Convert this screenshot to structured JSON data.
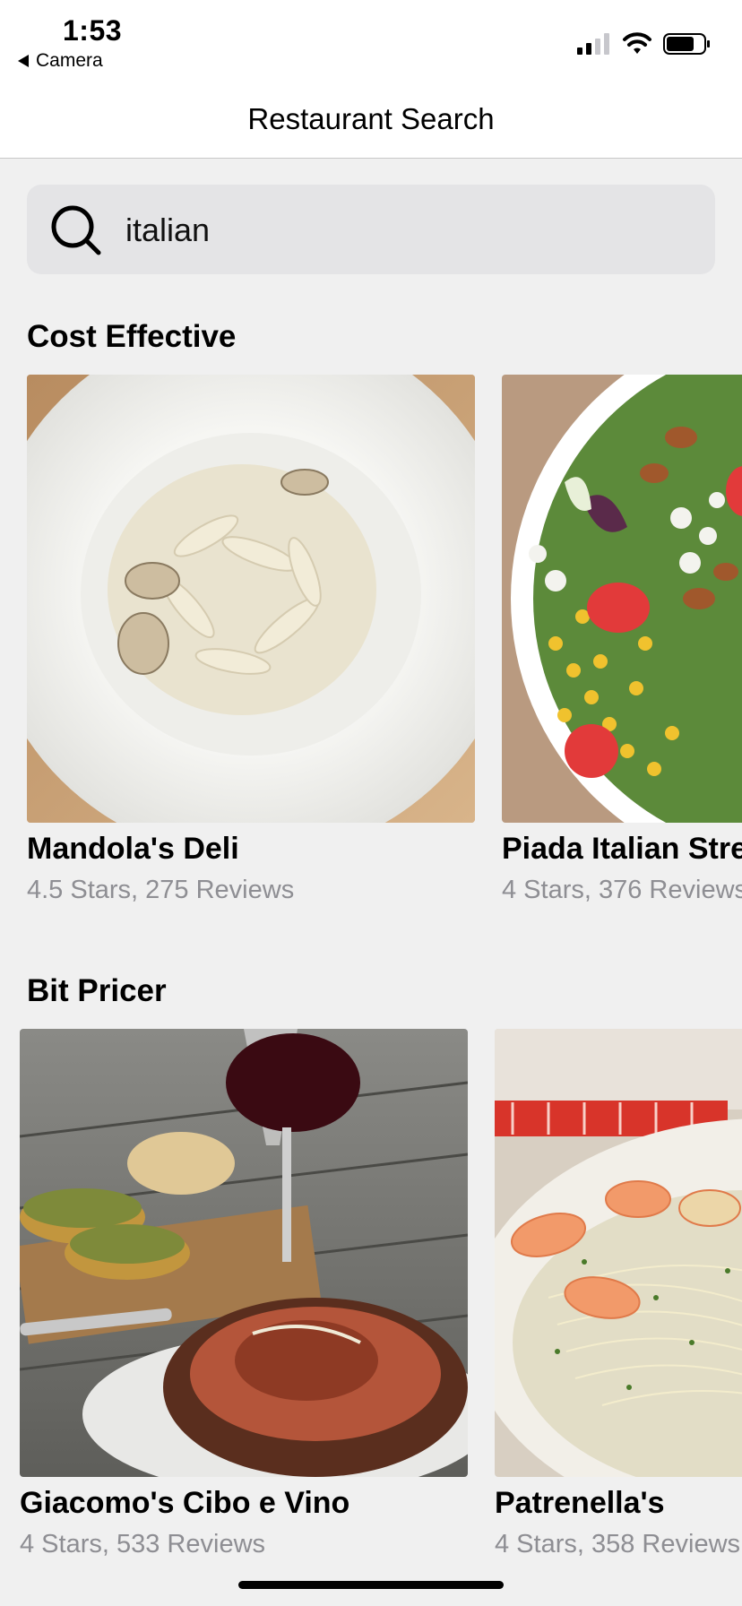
{
  "status": {
    "time": "1:53",
    "back_label": "Camera"
  },
  "nav": {
    "title": "Restaurant Search"
  },
  "search": {
    "value": "italian"
  },
  "sections": [
    {
      "title": "Cost Effective",
      "items": [
        {
          "name": "Mandola's Deli",
          "meta": "4.5 Stars, 275 Reviews"
        },
        {
          "name": "Piada Italian Street Food",
          "meta": "4 Stars, 376 Reviews"
        }
      ]
    },
    {
      "title": "Bit Pricer",
      "items": [
        {
          "name": "Giacomo's Cibo e Vino",
          "meta": "4 Stars, 533 Reviews"
        },
        {
          "name": "Patrenella's",
          "meta": "4 Stars, 358 Reviews"
        }
      ]
    }
  ],
  "colors": {
    "secondary_text": "#8e8e93",
    "search_bg": "#e4e4e6",
    "page_bg": "#f0f0f0"
  }
}
